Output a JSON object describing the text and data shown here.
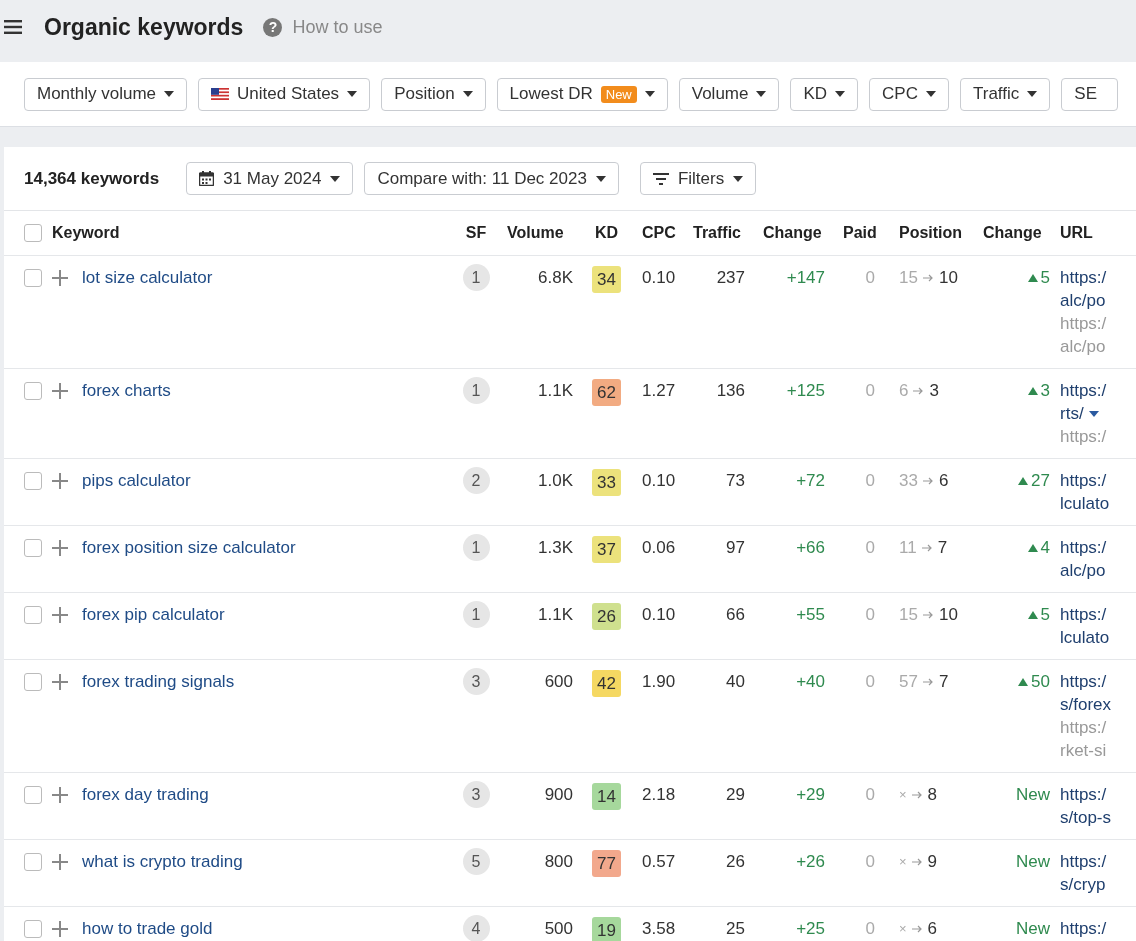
{
  "header": {
    "title": "Organic keywords",
    "help_icon": "?",
    "help": "How to use"
  },
  "filters": [
    {
      "label": "Monthly volume",
      "kind": "plain"
    },
    {
      "label": "United States",
      "kind": "flag"
    },
    {
      "label": "Position",
      "kind": "plain"
    },
    {
      "label": "Lowest DR",
      "kind": "badge",
      "badge": "New"
    },
    {
      "label": "Volume",
      "kind": "plain"
    },
    {
      "label": "KD",
      "kind": "plain"
    },
    {
      "label": "CPC",
      "kind": "plain"
    },
    {
      "label": "Traffic",
      "kind": "plain"
    },
    {
      "label": "SE",
      "kind": "cut"
    }
  ],
  "toolbar": {
    "count": "14,364 keywords",
    "date": "31 May 2024",
    "compare": "Compare with: 11 Dec 2023",
    "filters": "Filters"
  },
  "table": {
    "select_all_checked": false,
    "columns": [
      "Keyword",
      "SF",
      "Volume",
      "KD",
      "CPC",
      "Traffic",
      "Change",
      "Paid",
      "Position",
      "Change",
      "URL"
    ],
    "rows": [
      {
        "checked": false,
        "keyword": "lot size calculator",
        "sf": "1",
        "volume": "6.8K",
        "kd": "34",
        "color": "#ece27c",
        "cpc": "0.10",
        "traffic": "237",
        "change": "+147",
        "paid": "0",
        "pos_from": "15",
        "pos_to": "10",
        "pos_change": {
          "kind": "up",
          "text": "5"
        },
        "url": [
          {
            "text": "https:/",
            "kind": "main"
          },
          {
            "text": "alc/po",
            "kind": "main"
          },
          {
            "text": "https:/",
            "kind": "old"
          },
          {
            "text": "alc/po",
            "kind": "old"
          }
        ]
      },
      {
        "checked": false,
        "keyword": "forex charts",
        "sf": "1",
        "volume": "1.1K",
        "kd": "62",
        "color": "#f2ab82",
        "cpc": "1.27",
        "traffic": "136",
        "change": "+125",
        "paid": "0",
        "pos_from": "6",
        "pos_to": "3",
        "pos_change": {
          "kind": "up",
          "text": "3"
        },
        "url": [
          {
            "text": "https:/",
            "kind": "main"
          },
          {
            "text": "rts/",
            "kind": "menu"
          },
          {
            "text": "https:/",
            "kind": "old"
          }
        ]
      },
      {
        "checked": false,
        "keyword": "pips calculator",
        "sf": "2",
        "volume": "1.0K",
        "kd": "33",
        "color": "#ece27c",
        "cpc": "0.10",
        "traffic": "73",
        "change": "+72",
        "paid": "0",
        "pos_from": "33",
        "pos_to": "6",
        "pos_change": {
          "kind": "up",
          "text": "27"
        },
        "url": [
          {
            "text": "https:/",
            "kind": "main"
          },
          {
            "text": "lculato",
            "kind": "main"
          }
        ]
      },
      {
        "checked": false,
        "keyword": "forex position size calculator",
        "sf": "1",
        "volume": "1.3K",
        "kd": "37",
        "color": "#ece27c",
        "cpc": "0.06",
        "traffic": "97",
        "change": "+66",
        "paid": "0",
        "pos_from": "11",
        "pos_to": "7",
        "pos_change": {
          "kind": "up",
          "text": "4"
        },
        "url": [
          {
            "text": "https:/",
            "kind": "main"
          },
          {
            "text": "alc/po",
            "kind": "main"
          }
        ]
      },
      {
        "checked": false,
        "keyword": "forex pip calculator",
        "sf": "1",
        "volume": "1.1K",
        "kd": "26",
        "color": "#cfe08e",
        "cpc": "0.10",
        "traffic": "66",
        "change": "+55",
        "paid": "0",
        "pos_from": "15",
        "pos_to": "10",
        "pos_change": {
          "kind": "up",
          "text": "5"
        },
        "url": [
          {
            "text": "https:/",
            "kind": "main"
          },
          {
            "text": "lculato",
            "kind": "main"
          }
        ]
      },
      {
        "checked": false,
        "keyword": "forex trading signals",
        "sf": "3",
        "volume": "600",
        "kd": "42",
        "color": "#f5d862",
        "cpc": "1.90",
        "traffic": "40",
        "change": "+40",
        "paid": "0",
        "pos_from": "57",
        "pos_to": "7",
        "pos_change": {
          "kind": "up",
          "text": "50"
        },
        "url": [
          {
            "text": "https:/",
            "kind": "main"
          },
          {
            "text": "s/forex",
            "kind": "main"
          },
          {
            "text": "https:/",
            "kind": "old"
          },
          {
            "text": "rket-si",
            "kind": "old"
          }
        ]
      },
      {
        "checked": false,
        "keyword": "forex day trading",
        "sf": "3",
        "volume": "900",
        "kd": "14",
        "color": "#a6d89c",
        "cpc": "2.18",
        "traffic": "29",
        "change": "+29",
        "paid": "0",
        "pos_from": "×",
        "pos_to": "8",
        "pos_change": {
          "kind": "new",
          "text": "New"
        },
        "url": [
          {
            "text": "https:/",
            "kind": "main"
          },
          {
            "text": "s/top-s",
            "kind": "main"
          }
        ]
      },
      {
        "checked": false,
        "keyword": "what is crypto trading",
        "sf": "5",
        "volume": "800",
        "kd": "77",
        "color": "#f2a88c",
        "cpc": "0.57",
        "traffic": "26",
        "change": "+26",
        "paid": "0",
        "pos_from": "×",
        "pos_to": "9",
        "pos_change": {
          "kind": "new",
          "text": "New"
        },
        "url": [
          {
            "text": "https:/",
            "kind": "main"
          },
          {
            "text": "s/cryp",
            "kind": "main"
          }
        ]
      },
      {
        "checked": false,
        "keyword": "how to trade gold",
        "sf": "4",
        "volume": "500",
        "kd": "19",
        "color": "#a6d89c",
        "cpc": "3.58",
        "traffic": "25",
        "change": "+25",
        "paid": "0",
        "pos_from": "×",
        "pos_to": "6",
        "pos_change": {
          "kind": "new",
          "text": "New"
        },
        "url": [
          {
            "text": "https:/",
            "kind": "main"
          }
        ]
      }
    ]
  }
}
